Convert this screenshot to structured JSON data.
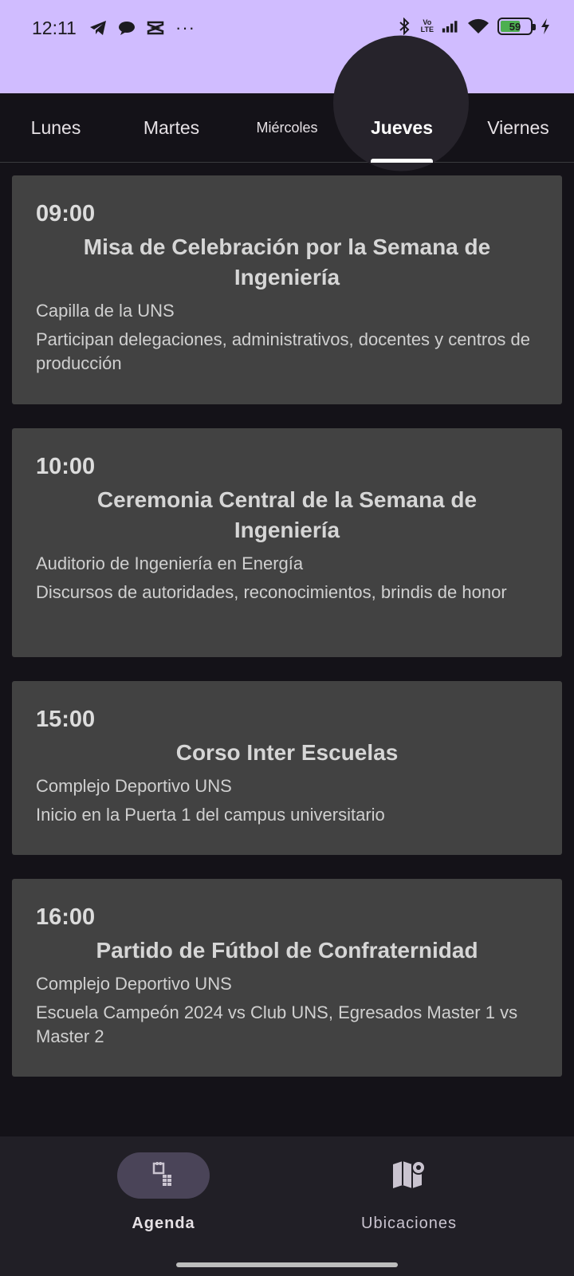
{
  "status_bar": {
    "time": "12:11",
    "left_icons": [
      "telegram-icon",
      "chat-bubble-icon",
      "capcut-icon"
    ],
    "more": "···",
    "right_icons": [
      "bluetooth-icon",
      "volte-icon",
      "signal-icon",
      "wifi-icon"
    ],
    "lte_top": "Vo",
    "lte_bottom": "LTE",
    "battery_level": "59",
    "charging_icon": "bolt-icon",
    "background_color": "#d0bcff"
  },
  "tabs": {
    "items": [
      {
        "label": "Lunes"
      },
      {
        "label": "Martes"
      },
      {
        "label": "Miércoles"
      },
      {
        "label": "Jueves"
      },
      {
        "label": "Viernes"
      }
    ],
    "active": "Jueves"
  },
  "events": [
    {
      "time": "09:00",
      "title": "Misa de Celebración por la Semana de Ingeniería",
      "place": "Capilla de la UNS",
      "description": "Participan delegaciones, administrativos, docentes y centros de producción"
    },
    {
      "time": "10:00",
      "title": "Ceremonia Central de la Semana de Ingeniería",
      "place": "Auditorio de Ingeniería en Energía",
      "description": "Discursos de autoridades, reconocimientos, brindis de honor"
    },
    {
      "time": "15:00",
      "title": "Corso Inter Escuelas",
      "place": "Complejo Deportivo UNS",
      "description": "Inicio en la Puerta 1 del campus universitario"
    },
    {
      "time": "16:00",
      "title": "Partido de Fútbol de Confraternidad",
      "place": "Complejo Deportivo UNS",
      "description": "Escuela Campeón 2024 vs Club UNS, Egresados Master 1 vs Master 2"
    }
  ],
  "bottom_nav": {
    "items": [
      {
        "label": "Agenda",
        "icon": "calendar-icon",
        "active": true
      },
      {
        "label": "Ubicaciones",
        "icon": "map-icon",
        "active": false
      }
    ]
  }
}
